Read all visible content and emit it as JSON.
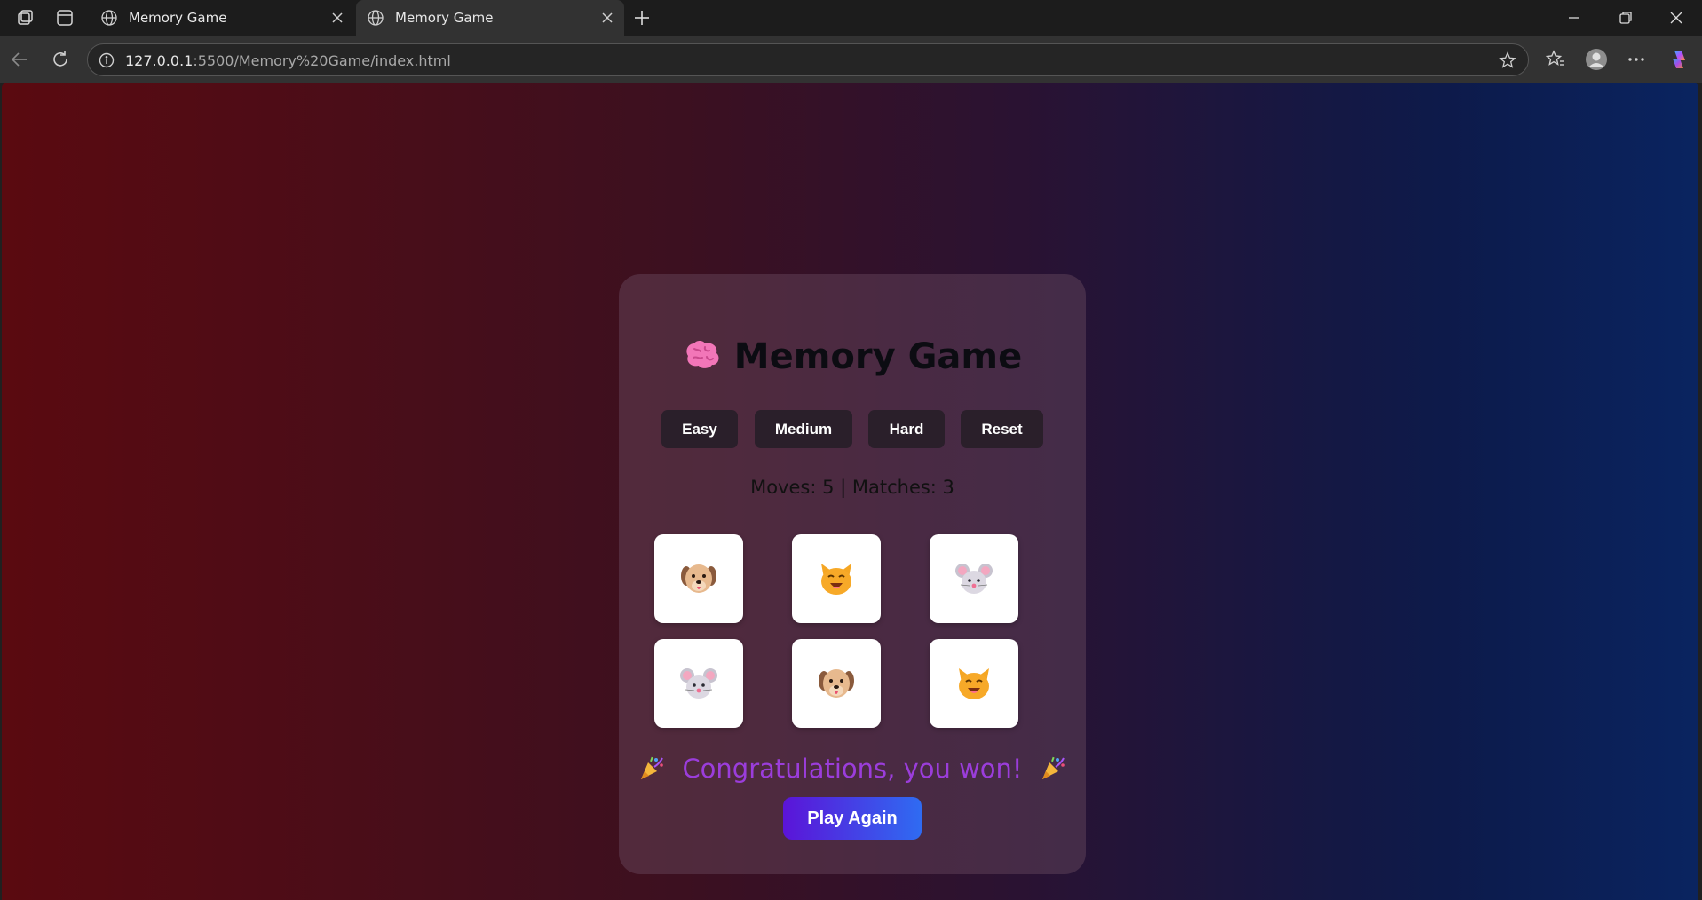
{
  "browser": {
    "tabs": [
      {
        "title": "Memory Game",
        "active": false
      },
      {
        "title": "Memory Game",
        "active": true
      }
    ],
    "url_host": "127.0.0.1",
    "url_path": ":5500/Memory%20Game/index.html"
  },
  "game": {
    "title": "Memory Game",
    "title_icon": "brain-icon",
    "levels": [
      "Easy",
      "Medium",
      "Hard",
      "Reset"
    ],
    "stats": "Moves: 5 | Matches: 3",
    "cards": [
      {
        "icon": "dog-face"
      },
      {
        "icon": "cat-face"
      },
      {
        "icon": "mouse-face"
      },
      {
        "icon": "mouse-face"
      },
      {
        "icon": "dog-face"
      },
      {
        "icon": "cat-face"
      }
    ],
    "win_message": "Congratulations, you won!",
    "win_icon": "party-popper-icon",
    "play_again_label": "Play Again"
  },
  "colors": {
    "accent_purple": "#9b3ddb",
    "button_gradient_start": "#5b14d8",
    "button_gradient_end": "#2f6bf2",
    "background_left": "#5a0a10",
    "background_right": "#0a2460"
  }
}
